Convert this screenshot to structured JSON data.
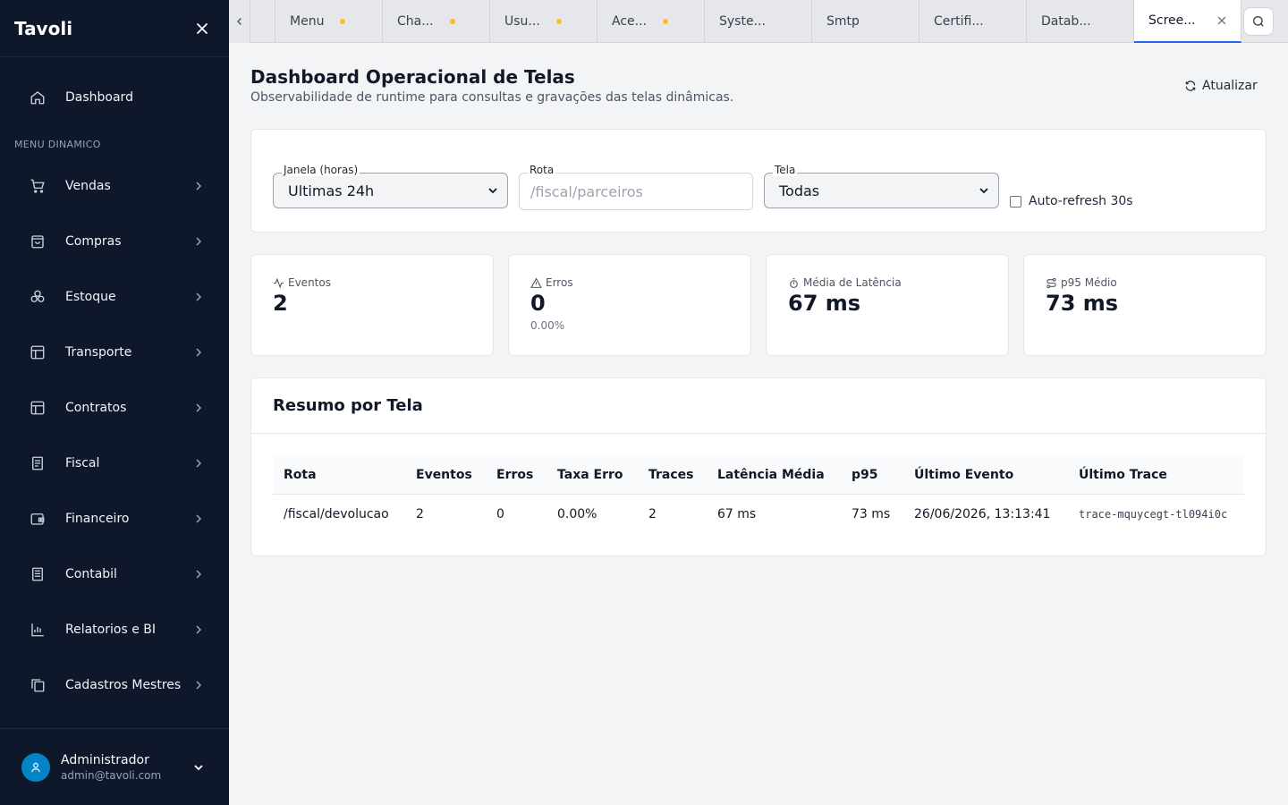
{
  "sidebar": {
    "brand": "Tavoli",
    "dashboard_label": "Dashboard",
    "section_label": "MENU DINAMICO",
    "items": [
      {
        "label": "Vendas",
        "icon": "cart-icon"
      },
      {
        "label": "Compras",
        "icon": "shopping-bag-icon"
      },
      {
        "label": "Estoque",
        "icon": "boxes-icon"
      },
      {
        "label": "Transporte",
        "icon": "layout-icon"
      },
      {
        "label": "Contratos",
        "icon": "layout-icon"
      },
      {
        "label": "Fiscal",
        "icon": "receipt-icon"
      },
      {
        "label": "Financeiro",
        "icon": "wallet-icon"
      },
      {
        "label": "Contabil",
        "icon": "book-icon"
      },
      {
        "label": "Relatorios e BI",
        "icon": "bar-chart-icon"
      },
      {
        "label": "Cadastros Mestres",
        "icon": "copy-icon"
      }
    ],
    "user": {
      "name": "Administrador",
      "email": "admin@tavoli.com"
    }
  },
  "tabs": [
    {
      "label": "Menu",
      "dirty": true
    },
    {
      "label": "Cha...",
      "dirty": true
    },
    {
      "label": "Usu...",
      "dirty": true
    },
    {
      "label": "Ace...",
      "dirty": true
    },
    {
      "label": "Syste...",
      "dirty": false
    },
    {
      "label": "Smtp",
      "dirty": false
    },
    {
      "label": "Certifi...",
      "dirty": false
    },
    {
      "label": "Datab...",
      "dirty": false
    },
    {
      "label": "Scree...",
      "dirty": false,
      "active": true
    }
  ],
  "header": {
    "title": "Dashboard Operacional de Telas",
    "subtitle": "Observabilidade de runtime para consultas e gravações das telas dinâmicas.",
    "refresh_label": "Atualizar"
  },
  "filters": {
    "window": {
      "label": "Janela (horas)",
      "value": "Ultimas 24h"
    },
    "route": {
      "label": "Rota",
      "placeholder": "/fiscal/parceiros",
      "value": ""
    },
    "screen": {
      "label": "Tela",
      "value": "Todas"
    },
    "auto_refresh": {
      "label": "Auto-refresh 30s",
      "checked": false
    }
  },
  "stats": [
    {
      "label": "Eventos",
      "value": "2",
      "sub": "",
      "icon": "activity-icon"
    },
    {
      "label": "Erros",
      "value": "0",
      "sub": "0.00%",
      "icon": "alert-triangle-icon"
    },
    {
      "label": "Média de Latência",
      "value": "67 ms",
      "sub": "",
      "icon": "timer-icon"
    },
    {
      "label": "p95 Médio",
      "value": "73 ms",
      "sub": "",
      "icon": "route-icon"
    }
  ],
  "summary": {
    "title": "Resumo por Tela",
    "columns": [
      "Rota",
      "Eventos",
      "Erros",
      "Taxa Erro",
      "Traces",
      "Latência Média",
      "p95",
      "Último Evento",
      "Último Trace"
    ],
    "rows": [
      [
        "/fiscal/devolucao",
        "2",
        "0",
        "0.00%",
        "2",
        "67 ms",
        "73 ms",
        "26/06/2026, 13:13:41",
        "trace-mquycegt-tl094i0c"
      ]
    ]
  }
}
